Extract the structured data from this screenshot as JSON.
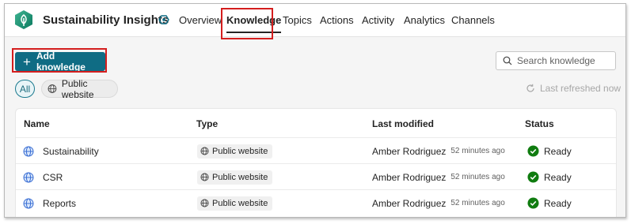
{
  "app": {
    "title": "Sustainability Insights",
    "logo_icon": "leaf-hexagon-icon",
    "accent": "#0f6c84"
  },
  "nav": [
    {
      "label": "Overview",
      "active": false
    },
    {
      "label": "Knowledge",
      "active": true
    },
    {
      "label": "Topics",
      "active": false
    },
    {
      "label": "Actions",
      "active": false
    },
    {
      "label": "Activity",
      "active": false
    },
    {
      "label": "Analytics",
      "active": false
    },
    {
      "label": "Channels",
      "active": false
    }
  ],
  "toolbar": {
    "add_label": "Add knowledge",
    "search_placeholder": "Search knowledge"
  },
  "filters": {
    "all_label": "All",
    "web_label": "Public website"
  },
  "refresh": {
    "label": "Last refreshed now"
  },
  "table": {
    "headers": {
      "name": "Name",
      "type": "Type",
      "modified": "Last modified",
      "status": "Status"
    },
    "rows": [
      {
        "name": "Sustainability",
        "type": "Public website",
        "author": "Amber Rodriguez",
        "time": "52 minutes ago",
        "status": "Ready"
      },
      {
        "name": "CSR",
        "type": "Public website",
        "author": "Amber Rodriguez",
        "time": "52 minutes ago",
        "status": "Ready"
      },
      {
        "name": "Reports",
        "type": "Public website",
        "author": "Amber Rodriguez",
        "time": "52 minutes ago",
        "status": "Ready"
      }
    ]
  },
  "colors": {
    "highlight": "#d41e1e",
    "ready": "#107c10"
  }
}
